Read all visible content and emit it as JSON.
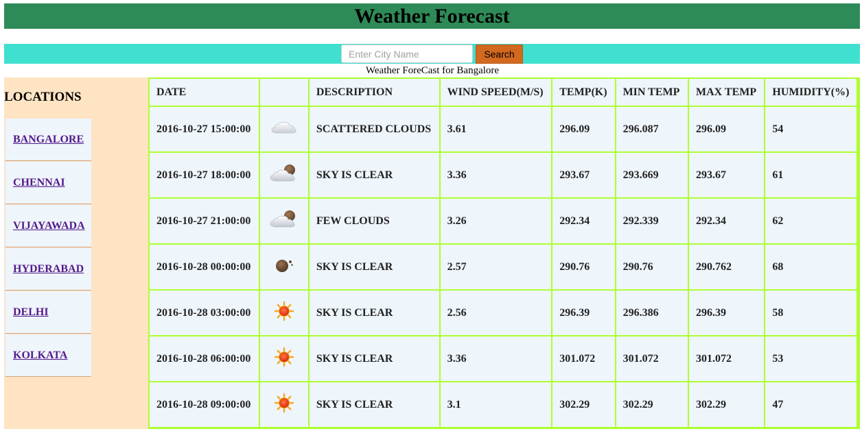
{
  "header": {
    "title": "Weather Forecast"
  },
  "search": {
    "placeholder": "Enter City Name",
    "value": "",
    "button_label": "Search"
  },
  "caption": "Weather ForeCast for Bangalore",
  "sidebar": {
    "heading": "LOCATIONS",
    "items": [
      {
        "label": "BANGALORE"
      },
      {
        "label": "CHENNAI"
      },
      {
        "label": "VIJAYAWADA"
      },
      {
        "label": "HYDERABAD"
      },
      {
        "label": "DELHI"
      },
      {
        "label": "KOLKATA"
      }
    ]
  },
  "table": {
    "headers": [
      "DATE",
      "",
      "DESCRIPTION",
      "WIND SPEED(M/S)",
      "TEMP(K)",
      "MIN TEMP",
      "MAX TEMP",
      "HUMIDITY(%)"
    ],
    "rows": [
      {
        "date": "2016-10-27 15:00:00",
        "icon": "cloud-icon",
        "description": "SCATTERED CLOUDS",
        "wind": "3.61",
        "temp": "296.09",
        "min": "296.087",
        "max": "296.09",
        "humidity": "54"
      },
      {
        "date": "2016-10-27 18:00:00",
        "icon": "cloud-moon-icon",
        "description": "SKY IS CLEAR",
        "wind": "3.36",
        "temp": "293.67",
        "min": "293.669",
        "max": "293.67",
        "humidity": "61"
      },
      {
        "date": "2016-10-27 21:00:00",
        "icon": "cloud-moon-icon",
        "description": "FEW CLOUDS",
        "wind": "3.26",
        "temp": "292.34",
        "min": "292.339",
        "max": "292.34",
        "humidity": "62"
      },
      {
        "date": "2016-10-28 00:00:00",
        "icon": "moon-icon",
        "description": "SKY IS CLEAR",
        "wind": "2.57",
        "temp": "290.76",
        "min": "290.76",
        "max": "290.762",
        "humidity": "68"
      },
      {
        "date": "2016-10-28 03:00:00",
        "icon": "sun-icon",
        "description": "SKY IS CLEAR",
        "wind": "2.56",
        "temp": "296.39",
        "min": "296.386",
        "max": "296.39",
        "humidity": "58"
      },
      {
        "date": "2016-10-28 06:00:00",
        "icon": "sun-icon",
        "description": "SKY IS CLEAR",
        "wind": "3.36",
        "temp": "301.072",
        "min": "301.072",
        "max": "301.072",
        "humidity": "53"
      },
      {
        "date": "2016-10-28 09:00:00",
        "icon": "sun-icon",
        "description": "SKY IS CLEAR",
        "wind": "3.1",
        "temp": "302.29",
        "min": "302.29",
        "max": "302.29",
        "humidity": "47"
      }
    ]
  },
  "colors": {
    "title_bg": "#2e8b57",
    "search_bg": "#40e0d0",
    "search_button": "#d2691e",
    "sidebar_bg": "#ffe4c4",
    "table_border": "#adff2f",
    "cell_bg": "#eef5fb"
  }
}
